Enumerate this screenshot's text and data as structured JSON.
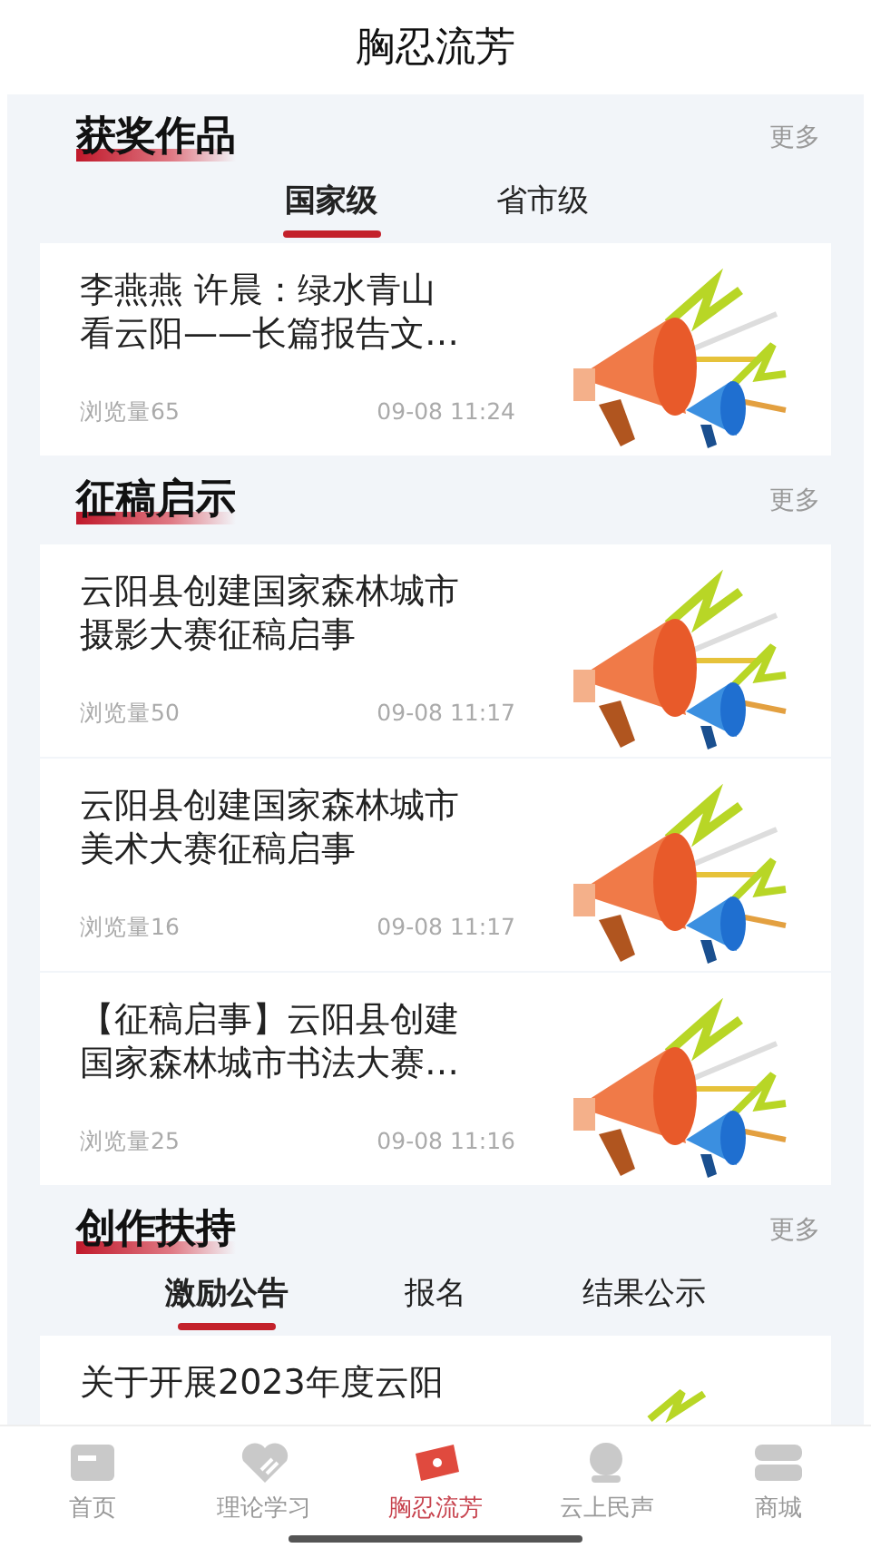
{
  "header": {
    "title": "胸忍流芳"
  },
  "sections": [
    {
      "title": "获奖作品",
      "more": "更多",
      "tabs": [
        {
          "label": "国家级",
          "selected": true
        },
        {
          "label": "省市级",
          "selected": false
        }
      ],
      "items": [
        {
          "title": "李燕燕 许晨：绿水青山看云阳——长篇报告文…",
          "views": "浏览量65",
          "time": "09-08 11:24"
        }
      ]
    },
    {
      "title": "征稿启示",
      "more": "更多",
      "items": [
        {
          "title": "云阳县创建国家森林城市摄影大赛征稿启事",
          "views": "浏览量50",
          "time": "09-08 11:17"
        },
        {
          "title": "云阳县创建国家森林城市美术大赛征稿启事",
          "views": "浏览量16",
          "time": "09-08 11:17"
        },
        {
          "title": "【征稿启事】云阳县创建国家森林城市书法大赛…",
          "views": "浏览量25",
          "time": "09-08 11:16"
        }
      ]
    },
    {
      "title": "创作扶持",
      "more": "更多",
      "tabs": [
        {
          "label": "激励公告",
          "selected": true
        },
        {
          "label": "报名",
          "selected": false
        },
        {
          "label": "结果公示",
          "selected": false
        }
      ],
      "items": [
        {
          "title": "关于开展2023年度云阳"
        }
      ]
    }
  ],
  "bottom_nav": [
    {
      "label": "首页",
      "selected": false
    },
    {
      "label": "理论学习",
      "selected": false
    },
    {
      "label": "胸忍流芳",
      "selected": true
    },
    {
      "label": "云上民声",
      "selected": false
    },
    {
      "label": "商城",
      "selected": false
    }
  ]
}
